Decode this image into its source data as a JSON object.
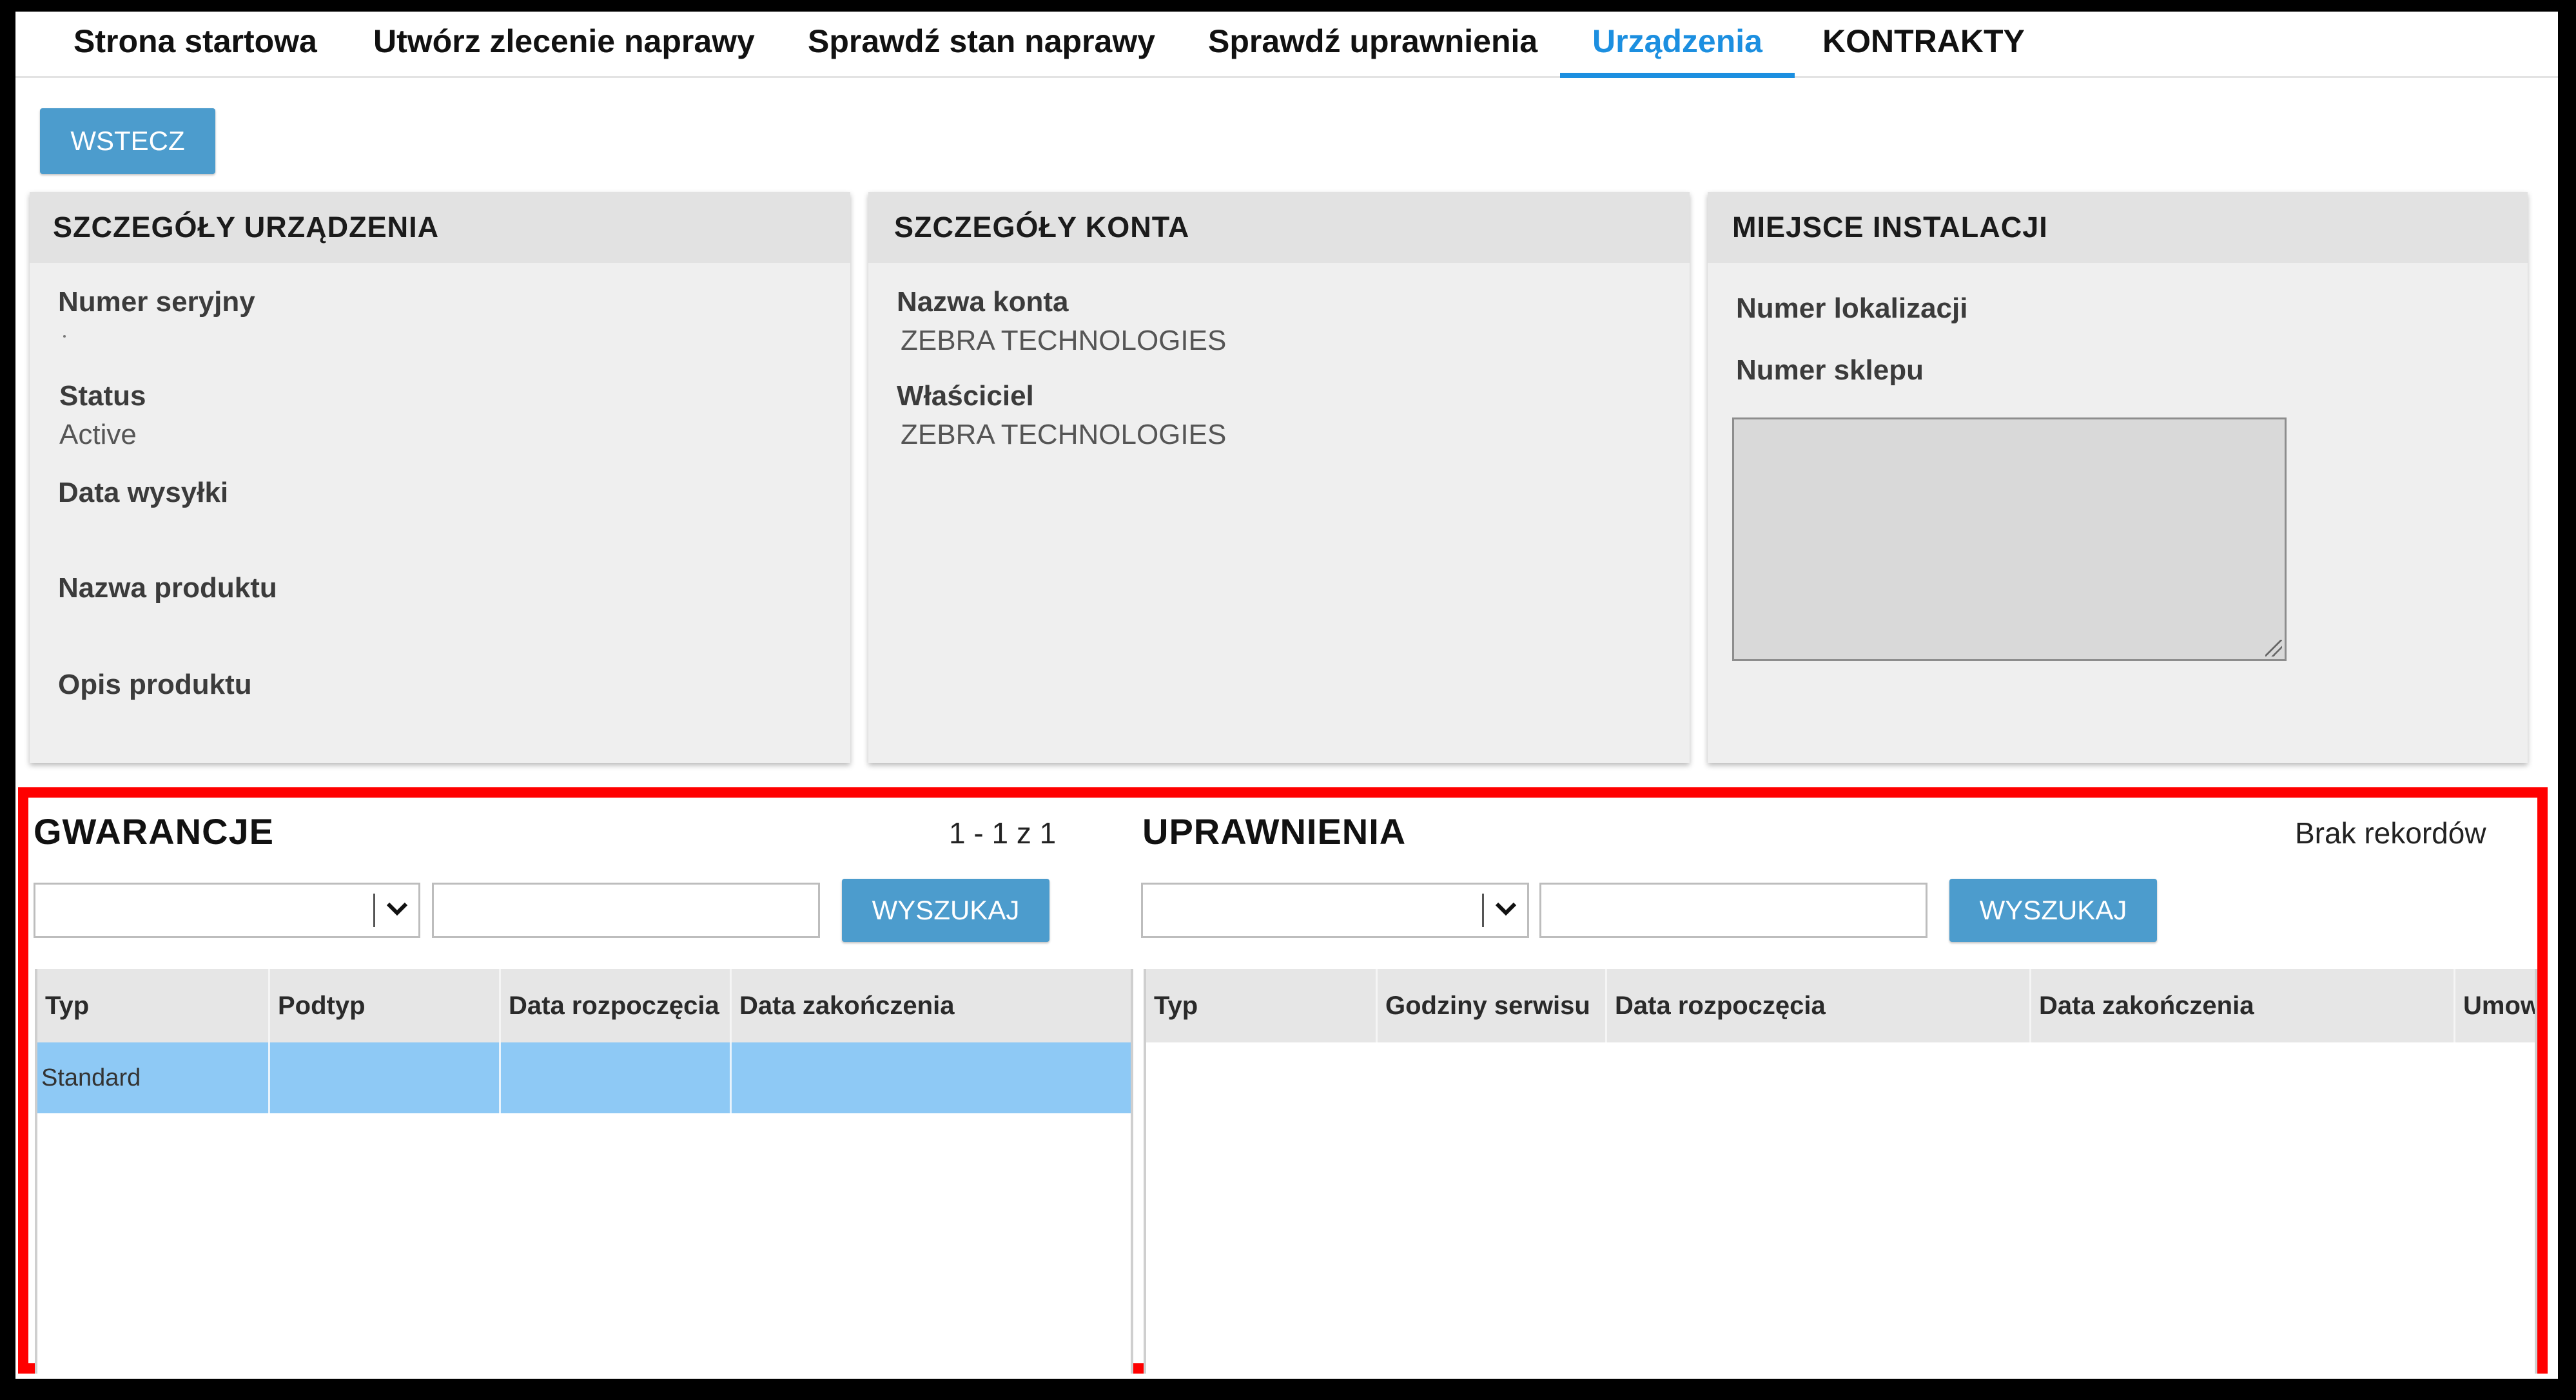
{
  "nav": {
    "tabs": [
      {
        "label": "Strona startowa"
      },
      {
        "label": "Utwórz zlecenie naprawy"
      },
      {
        "label": "Sprawdź stan naprawy"
      },
      {
        "label": "Sprawdź uprawnienia"
      },
      {
        "label": "Urządzenia",
        "active": true
      },
      {
        "label": "KONTRAKTY"
      }
    ]
  },
  "back_button": "WSTECZ",
  "device_details": {
    "title": "SZCZEGÓŁY URZĄDZENIA",
    "serial_label": "Numer seryjny",
    "status_label": "Status",
    "status_value": "Active",
    "ship_date_label": "Data wysyłki",
    "product_name_label": "Nazwa produktu",
    "product_desc_label": "Opis produktu"
  },
  "account_details": {
    "title": "SZCZEGÓŁY KONTA",
    "account_name_label": "Nazwa konta",
    "account_name_value": "ZEBRA TECHNOLOGIES",
    "owner_label": "Właściciel",
    "owner_value": "ZEBRA TECHNOLOGIES"
  },
  "install_location": {
    "title": "MIEJSCE INSTALACJI",
    "location_number_label": "Numer lokalizacji",
    "store_number_label": "Numer sklepu",
    "notes_value": ""
  },
  "warranties": {
    "title": "GWARANCJE",
    "count": "1 - 1 z 1",
    "filter_value": "",
    "search_value": "",
    "search_button": "WYSZUKAJ",
    "columns": [
      "Typ",
      "Podtyp",
      "Data rozpoczęcia",
      "Data zakończenia"
    ],
    "rows": [
      [
        "Standard",
        "",
        "",
        ""
      ]
    ]
  },
  "entitlements": {
    "title": "UPRAWNIENIA",
    "count": "Brak rekordów",
    "filter_value": "",
    "search_value": "",
    "search_button": "WYSZUKAJ",
    "columns": [
      "Typ",
      "Godziny serwisu",
      "Data rozpoczęcia",
      "Data zakończenia",
      "Umowa"
    ],
    "rows": []
  },
  "colors": {
    "accent": "#1c8fe0",
    "button": "#4c9ccd",
    "selected_row": "#8ec9f5",
    "highlight_frame": "#ff0000"
  }
}
